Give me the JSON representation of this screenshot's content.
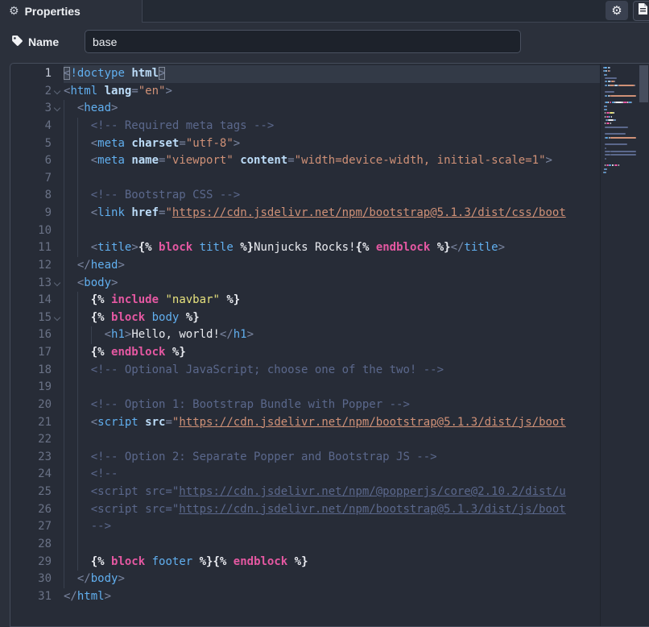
{
  "topbar": {
    "tab_label": "Properties",
    "icons": {
      "tab": "gear-icon",
      "settings_button": "gear-icon",
      "docs_button": "doc-icon"
    }
  },
  "name_row": {
    "label": "Name",
    "icon": "tag-icon",
    "value": "base"
  },
  "colors": {
    "panel_bg": "#2b303b",
    "editor_bg": "#272c37",
    "current_line_bg": "#333a47",
    "input_bg": "#1d222b",
    "accent_border": "#4a5160",
    "syntax": {
      "sp": "",
      "tag": "#61afef",
      "attr": "#bcdcf8",
      "pu": "#7b86a1",
      "st": "#d09177",
      "url": "#d09177",
      "cm": "#5b688c",
      "cu": "#5b688c",
      "de": "#e9ebf0",
      "kw": "#e558a2",
      "bn": "#61afef",
      "ys": "#e7e27d",
      "tx": "#e9ebf0"
    }
  },
  "editor": {
    "lines": [
      {
        "n": 1,
        "cur": true,
        "tok": [
          [
            "pu",
            "<",
            "box"
          ],
          [
            "tag",
            "!doctype"
          ],
          [
            "sp",
            " "
          ],
          [
            "attr",
            "html"
          ],
          [
            "pu",
            ">",
            "box"
          ]
        ]
      },
      {
        "n": 2,
        "fold": true,
        "tok": [
          [
            "pu",
            "<"
          ],
          [
            "tag",
            "html"
          ],
          [
            "sp",
            " "
          ],
          [
            "attr",
            "lang"
          ],
          [
            "pu",
            "="
          ],
          [
            "st",
            "\"en\""
          ],
          [
            "pu",
            ">"
          ]
        ]
      },
      {
        "n": 3,
        "fold": true,
        "tok": [
          [
            "sp",
            "  "
          ],
          [
            "pu",
            "<"
          ],
          [
            "tag",
            "head"
          ],
          [
            "pu",
            ">"
          ]
        ]
      },
      {
        "n": 4,
        "tok": [
          [
            "sp",
            "    "
          ],
          [
            "cm",
            "<!-- Required meta tags -->"
          ]
        ]
      },
      {
        "n": 5,
        "tok": [
          [
            "sp",
            "    "
          ],
          [
            "pu",
            "<"
          ],
          [
            "tag",
            "meta"
          ],
          [
            "sp",
            " "
          ],
          [
            "attr",
            "charset"
          ],
          [
            "pu",
            "="
          ],
          [
            "st",
            "\"utf-8\""
          ],
          [
            "pu",
            ">"
          ]
        ]
      },
      {
        "n": 6,
        "tok": [
          [
            "sp",
            "    "
          ],
          [
            "pu",
            "<"
          ],
          [
            "tag",
            "meta"
          ],
          [
            "sp",
            " "
          ],
          [
            "attr",
            "name"
          ],
          [
            "pu",
            "="
          ],
          [
            "st",
            "\"viewport\""
          ],
          [
            "sp",
            " "
          ],
          [
            "attr",
            "content"
          ],
          [
            "pu",
            "="
          ],
          [
            "st",
            "\"width=device-width, initial-scale=1\""
          ],
          [
            "pu",
            ">"
          ]
        ]
      },
      {
        "n": 7,
        "gind": 4,
        "tok": []
      },
      {
        "n": 8,
        "tok": [
          [
            "sp",
            "    "
          ],
          [
            "cm",
            "<!-- Bootstrap CSS -->"
          ]
        ]
      },
      {
        "n": 9,
        "tok": [
          [
            "sp",
            "    "
          ],
          [
            "pu",
            "<"
          ],
          [
            "tag",
            "link"
          ],
          [
            "sp",
            " "
          ],
          [
            "attr",
            "href"
          ],
          [
            "pu",
            "="
          ],
          [
            "st",
            "\""
          ],
          [
            "url",
            "https://cdn.jsdelivr.net/npm/bootstrap@5.1.3/dist/css/boot"
          ]
        ]
      },
      {
        "n": 10,
        "gind": 4,
        "tok": []
      },
      {
        "n": 11,
        "tok": [
          [
            "sp",
            "    "
          ],
          [
            "pu",
            "<"
          ],
          [
            "tag",
            "title"
          ],
          [
            "pu",
            ">"
          ],
          [
            "de",
            "{%"
          ],
          [
            "sp",
            " "
          ],
          [
            "kw",
            "block"
          ],
          [
            "sp",
            " "
          ],
          [
            "bn",
            "title"
          ],
          [
            "sp",
            " "
          ],
          [
            "de",
            "%}"
          ],
          [
            "tx",
            "Nunjucks Rocks!"
          ],
          [
            "de",
            "{%"
          ],
          [
            "sp",
            " "
          ],
          [
            "kw",
            "endblock"
          ],
          [
            "sp",
            " "
          ],
          [
            "de",
            "%}"
          ],
          [
            "pu",
            "</"
          ],
          [
            "tag",
            "title"
          ],
          [
            "pu",
            ">"
          ]
        ]
      },
      {
        "n": 12,
        "tok": [
          [
            "sp",
            "  "
          ],
          [
            "pu",
            "</"
          ],
          [
            "tag",
            "head"
          ],
          [
            "pu",
            ">"
          ]
        ]
      },
      {
        "n": 13,
        "fold": true,
        "tok": [
          [
            "sp",
            "  "
          ],
          [
            "pu",
            "<"
          ],
          [
            "tag",
            "body"
          ],
          [
            "pu",
            ">"
          ]
        ]
      },
      {
        "n": 14,
        "tok": [
          [
            "sp",
            "    "
          ],
          [
            "de",
            "{%"
          ],
          [
            "sp",
            " "
          ],
          [
            "kw",
            "include"
          ],
          [
            "sp",
            " "
          ],
          [
            "ys",
            "\"navbar\""
          ],
          [
            "sp",
            " "
          ],
          [
            "de",
            "%}"
          ]
        ]
      },
      {
        "n": 15,
        "fold": true,
        "tok": [
          [
            "sp",
            "    "
          ],
          [
            "de",
            "{%"
          ],
          [
            "sp",
            " "
          ],
          [
            "kw",
            "block"
          ],
          [
            "sp",
            " "
          ],
          [
            "bn",
            "body"
          ],
          [
            "sp",
            " "
          ],
          [
            "de",
            "%}"
          ]
        ]
      },
      {
        "n": 16,
        "tok": [
          [
            "sp",
            "      "
          ],
          [
            "pu",
            "<"
          ],
          [
            "tag",
            "h1"
          ],
          [
            "pu",
            ">"
          ],
          [
            "tx",
            "Hello, world!"
          ],
          [
            "pu",
            "</"
          ],
          [
            "tag",
            "h1"
          ],
          [
            "pu",
            ">"
          ]
        ]
      },
      {
        "n": 17,
        "tok": [
          [
            "sp",
            "    "
          ],
          [
            "de",
            "{%"
          ],
          [
            "sp",
            " "
          ],
          [
            "kw",
            "endblock"
          ],
          [
            "sp",
            " "
          ],
          [
            "de",
            "%}"
          ]
        ]
      },
      {
        "n": 18,
        "tok": [
          [
            "sp",
            "    "
          ],
          [
            "cm",
            "<!-- Optional JavaScript; choose one of the two! -->"
          ]
        ]
      },
      {
        "n": 19,
        "gind": 4,
        "tok": []
      },
      {
        "n": 20,
        "tok": [
          [
            "sp",
            "    "
          ],
          [
            "cm",
            "<!-- Option 1: Bootstrap Bundle with Popper -->"
          ]
        ]
      },
      {
        "n": 21,
        "tok": [
          [
            "sp",
            "    "
          ],
          [
            "pu",
            "<"
          ],
          [
            "tag",
            "script"
          ],
          [
            "sp",
            " "
          ],
          [
            "attr",
            "src"
          ],
          [
            "pu",
            "="
          ],
          [
            "st",
            "\""
          ],
          [
            "url",
            "https://cdn.jsdelivr.net/npm/bootstrap@5.1.3/dist/js/boot"
          ]
        ]
      },
      {
        "n": 22,
        "gind": 4,
        "tok": []
      },
      {
        "n": 23,
        "tok": [
          [
            "sp",
            "    "
          ],
          [
            "cm",
            "<!-- Option 2: Separate Popper and Bootstrap JS -->"
          ]
        ]
      },
      {
        "n": 24,
        "tok": [
          [
            "sp",
            "    "
          ],
          [
            "cm",
            "<!--"
          ]
        ]
      },
      {
        "n": 25,
        "tok": [
          [
            "sp",
            "    "
          ],
          [
            "cm",
            "<script src=\""
          ],
          [
            "cu",
            "https://cdn.jsdelivr.net/npm/@popperjs/core@2.10.2/dist/u"
          ]
        ]
      },
      {
        "n": 26,
        "tok": [
          [
            "sp",
            "    "
          ],
          [
            "cm",
            "<script src=\""
          ],
          [
            "cu",
            "https://cdn.jsdelivr.net/npm/bootstrap@5.1.3/dist/js/boot"
          ]
        ]
      },
      {
        "n": 27,
        "tok": [
          [
            "sp",
            "    "
          ],
          [
            "cm",
            "-->"
          ]
        ]
      },
      {
        "n": 28,
        "gind": 4,
        "tok": []
      },
      {
        "n": 29,
        "tok": [
          [
            "sp",
            "    "
          ],
          [
            "de",
            "{%"
          ],
          [
            "sp",
            " "
          ],
          [
            "kw",
            "block"
          ],
          [
            "sp",
            " "
          ],
          [
            "bn",
            "footer"
          ],
          [
            "sp",
            " "
          ],
          [
            "de",
            "%}"
          ],
          [
            "de",
            "{%"
          ],
          [
            "sp",
            " "
          ],
          [
            "kw",
            "endblock"
          ],
          [
            "sp",
            " "
          ],
          [
            "de",
            "%}"
          ]
        ]
      },
      {
        "n": 30,
        "tok": [
          [
            "sp",
            "  "
          ],
          [
            "pu",
            "</"
          ],
          [
            "tag",
            "body"
          ],
          [
            "pu",
            ">"
          ]
        ]
      },
      {
        "n": 31,
        "tok": [
          [
            "pu",
            "</"
          ],
          [
            "tag",
            "html"
          ],
          [
            "pu",
            ">"
          ]
        ]
      }
    ]
  }
}
